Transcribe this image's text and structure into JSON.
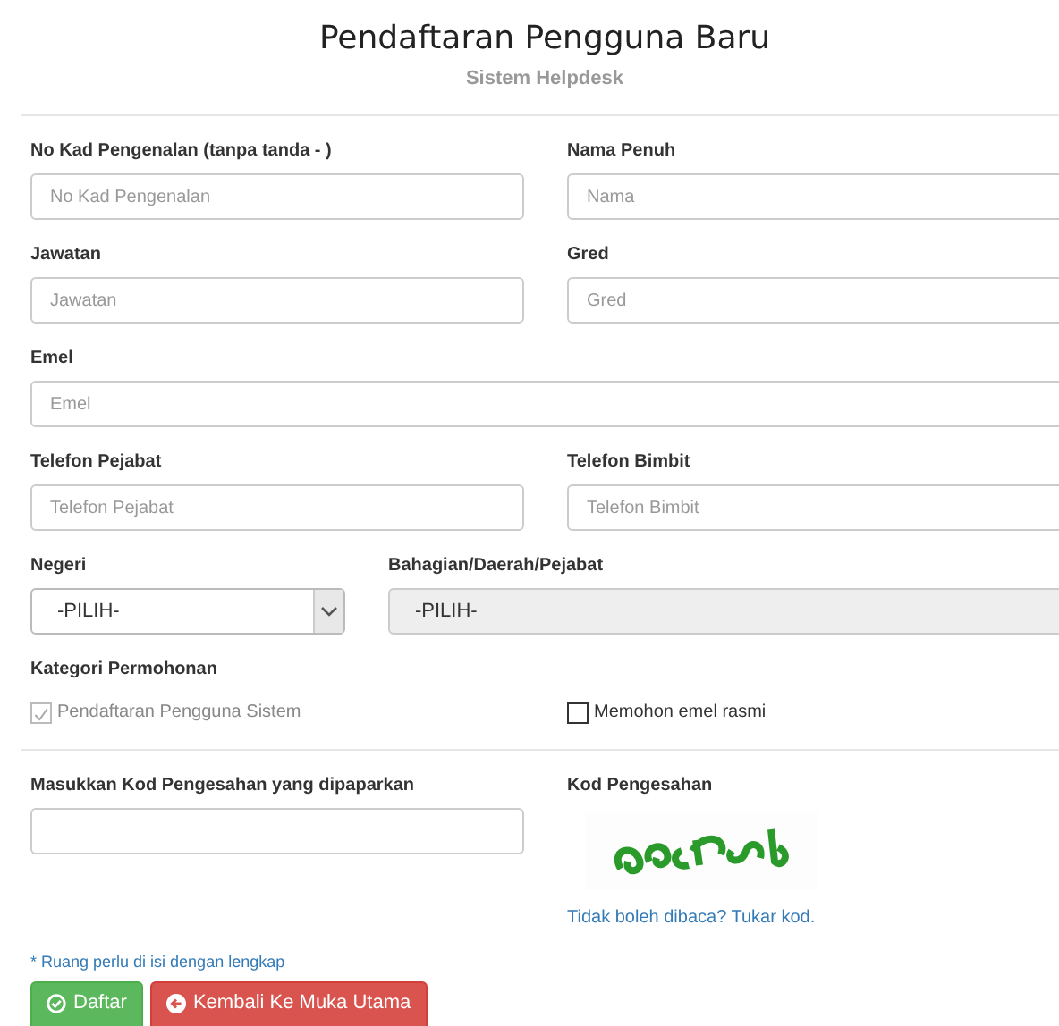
{
  "header": {
    "title": "Pendaftaran Pengguna Baru",
    "subtitle": "Sistem Helpdesk"
  },
  "rows": [
    {
      "fields": [
        {
          "kind": "text",
          "label": "No Kad Pengenalan (tanpa tanda - )",
          "placeholder": "No Kad Pengenalan"
        },
        {
          "kind": "text",
          "label": "Nama Penuh",
          "placeholder": "Nama"
        }
      ]
    },
    {
      "fields": [
        {
          "kind": "text",
          "label": "Jawatan",
          "placeholder": "Jawatan"
        },
        {
          "kind": "text",
          "label": "Gred",
          "placeholder": "Gred"
        }
      ]
    },
    {
      "fields": [
        {
          "kind": "text",
          "label": "Emel",
          "placeholder": "Emel"
        }
      ]
    },
    {
      "fields": [
        {
          "kind": "text",
          "label": "Telefon Pejabat",
          "placeholder": "Telefon Pejabat"
        },
        {
          "kind": "text",
          "label": "Telefon Bimbit",
          "placeholder": "Telefon Bimbit"
        }
      ]
    },
    {
      "fields": [
        {
          "kind": "select",
          "label": "Negeri",
          "value": "-PILIH-",
          "disabled": false
        },
        {
          "kind": "select",
          "label": "Bahagian/Daerah/Pejabat",
          "value": "-PILIH-",
          "disabled": true
        }
      ]
    }
  ],
  "category": {
    "label": "Kategori Permohonan",
    "options": [
      {
        "label": "Pendaftaran Pengguna Sistem",
        "checked": true,
        "disabled": true
      },
      {
        "label": "Memohon emel rasmi",
        "checked": false,
        "disabled": false
      }
    ]
  },
  "verification": {
    "input_label": "Masukkan Kod Pengesahan yang dipaparkan",
    "captcha_label": "Kod Pengesahan",
    "refresh_link": "Tidak boleh dibaca? Tukar kod."
  },
  "note": "* Ruang perlu di isi dengan lengkap",
  "buttons": [
    {
      "label": "Daftar",
      "kind": "success"
    },
    {
      "label": "Kembali Ke Muka Utama",
      "kind": "danger"
    }
  ]
}
